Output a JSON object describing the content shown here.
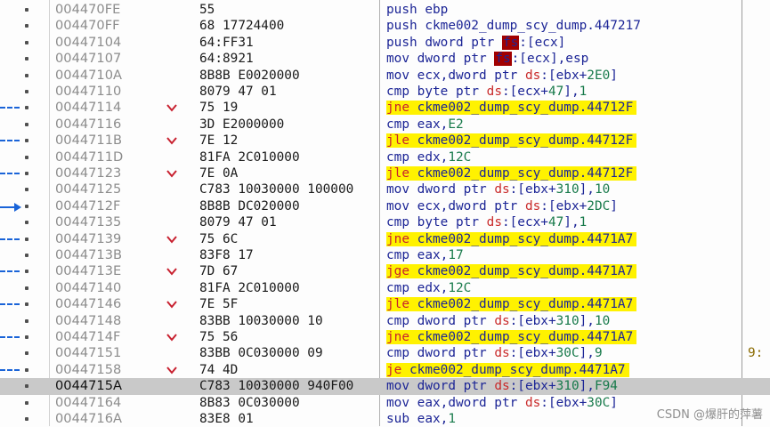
{
  "rows": [
    {
      "marker": "",
      "jump": false,
      "address": "004470FE",
      "bytes": "55",
      "mnemonic": "push",
      "operand": "ebp",
      "branch": false,
      "selected": false,
      "note": ""
    },
    {
      "marker": "",
      "jump": false,
      "address": "004470FF",
      "bytes": "68 17724400",
      "mnemonic": "push",
      "operand": "ckme002_dump_scy_dump.447217",
      "branch": false,
      "selected": false,
      "note": ""
    },
    {
      "marker": "",
      "jump": false,
      "address": "00447104",
      "bytes": "64:FF31",
      "mnemonic": "push",
      "operand": "dword ptr [[fs]]:[ecx]",
      "branch": false,
      "selected": false,
      "note": ""
    },
    {
      "marker": "",
      "jump": false,
      "address": "00447107",
      "bytes": "64:8921",
      "mnemonic": "mov",
      "operand": "dword ptr [[fs]]:[ecx],esp",
      "branch": false,
      "selected": false,
      "note": ""
    },
    {
      "marker": "",
      "jump": false,
      "address": "0044710A",
      "bytes": "8B8B E0020000",
      "mnemonic": "mov",
      "operand": "ecx,dword ptr ds:[ebx+2E0]",
      "branch": false,
      "selected": false,
      "note": ""
    },
    {
      "marker": "",
      "jump": false,
      "address": "00447110",
      "bytes": "8079 47 01",
      "mnemonic": "cmp",
      "operand": "byte ptr ds:[ecx+47],1",
      "branch": false,
      "selected": false,
      "note": ""
    },
    {
      "marker": "dash",
      "jump": true,
      "address": "00447114",
      "bytes": "75 19",
      "mnemonic": "jne",
      "operand": "ckme002_dump_scy_dump.44712F",
      "branch": true,
      "selected": false,
      "note": ""
    },
    {
      "marker": "",
      "jump": false,
      "address": "00447116",
      "bytes": "3D E2000000",
      "mnemonic": "cmp",
      "operand": "eax,E2",
      "branch": false,
      "selected": false,
      "note": ""
    },
    {
      "marker": "dash",
      "jump": true,
      "address": "0044711B",
      "bytes": "7E 12",
      "mnemonic": "jle",
      "operand": "ckme002_dump_scy_dump.44712F",
      "branch": true,
      "selected": false,
      "note": ""
    },
    {
      "marker": "",
      "jump": false,
      "address": "0044711D",
      "bytes": "81FA 2C010000",
      "mnemonic": "cmp",
      "operand": "edx,12C",
      "branch": false,
      "selected": false,
      "note": ""
    },
    {
      "marker": "dash",
      "jump": true,
      "address": "00447123",
      "bytes": "7E 0A",
      "mnemonic": "jle",
      "operand": "ckme002_dump_scy_dump.44712F",
      "branch": true,
      "selected": false,
      "note": ""
    },
    {
      "marker": "",
      "jump": false,
      "address": "00447125",
      "bytes": "C783 10030000 100000",
      "mnemonic": "mov",
      "operand": "dword ptr ds:[ebx+310],10",
      "branch": false,
      "selected": false,
      "note": ""
    },
    {
      "marker": "arrow",
      "jump": false,
      "address": "0044712F",
      "bytes": "8B8B DC020000",
      "mnemonic": "mov",
      "operand": "ecx,dword ptr ds:[ebx+2DC]",
      "branch": false,
      "selected": false,
      "note": ""
    },
    {
      "marker": "",
      "jump": false,
      "address": "00447135",
      "bytes": "8079 47 01",
      "mnemonic": "cmp",
      "operand": "byte ptr ds:[ecx+47],1",
      "branch": false,
      "selected": false,
      "note": ""
    },
    {
      "marker": "dash",
      "jump": true,
      "address": "00447139",
      "bytes": "75 6C",
      "mnemonic": "jne",
      "operand": "ckme002_dump_scy_dump.4471A7",
      "branch": true,
      "selected": false,
      "note": ""
    },
    {
      "marker": "",
      "jump": false,
      "address": "0044713B",
      "bytes": "83F8 17",
      "mnemonic": "cmp",
      "operand": "eax,17",
      "branch": false,
      "selected": false,
      "note": ""
    },
    {
      "marker": "dash",
      "jump": true,
      "address": "0044713E",
      "bytes": "7D 67",
      "mnemonic": "jge",
      "operand": "ckme002_dump_scy_dump.4471A7",
      "branch": true,
      "selected": false,
      "note": ""
    },
    {
      "marker": "",
      "jump": false,
      "address": "00447140",
      "bytes": "81FA 2C010000",
      "mnemonic": "cmp",
      "operand": "edx,12C",
      "branch": false,
      "selected": false,
      "note": ""
    },
    {
      "marker": "dash",
      "jump": true,
      "address": "00447146",
      "bytes": "7E 5F",
      "mnemonic": "jle",
      "operand": "ckme002_dump_scy_dump.4471A7",
      "branch": true,
      "selected": false,
      "note": ""
    },
    {
      "marker": "",
      "jump": false,
      "address": "00447148",
      "bytes": "83BB 10030000 10",
      "mnemonic": "cmp",
      "operand": "dword ptr ds:[ebx+310],10",
      "branch": false,
      "selected": false,
      "note": ""
    },
    {
      "marker": "dash",
      "jump": true,
      "address": "0044714F",
      "bytes": "75 56",
      "mnemonic": "jne",
      "operand": "ckme002_dump_scy_dump.4471A7",
      "branch": true,
      "selected": false,
      "note": ""
    },
    {
      "marker": "",
      "jump": false,
      "address": "00447151",
      "bytes": "83BB 0C030000 09",
      "mnemonic": "cmp",
      "operand": "dword ptr ds:[ebx+30C],9",
      "branch": false,
      "selected": false,
      "note": "9:"
    },
    {
      "marker": "dash",
      "jump": true,
      "address": "00447158",
      "bytes": "74 4D",
      "mnemonic": "je",
      "operand": "ckme002_dump_scy_dump.4471A7",
      "branch": true,
      "selected": false,
      "note": ""
    },
    {
      "marker": "",
      "jump": false,
      "address": "0044715A",
      "bytes": "C783 10030000 940F00",
      "mnemonic": "mov",
      "operand": "dword ptr ds:[ebx+310],F94",
      "branch": false,
      "selected": true,
      "note": ""
    },
    {
      "marker": "",
      "jump": false,
      "address": "00447164",
      "bytes": "8B83 0C030000",
      "mnemonic": "mov",
      "operand": "eax,dword ptr ds:[ebx+30C]",
      "branch": false,
      "selected": false,
      "note": ""
    },
    {
      "marker": "",
      "jump": false,
      "address": "0044716A",
      "bytes": "83E8 01",
      "mnemonic": "sub",
      "operand": "eax,1",
      "branch": false,
      "selected": false,
      "note": ""
    }
  ],
  "watermark": "CSDN @爆肝的萍薯",
  "colors": {
    "mnemonic": "#1c2596",
    "branch_mnemonic": "#c8202f",
    "number": "#187a4b",
    "segment": "#c92a2a",
    "branch_highlight": "#fff200",
    "selected_row": "#c9c9c9",
    "marker": "#1a64d8"
  },
  "icons": {
    "jump_chevron": "chevron-down-icon",
    "gutter_bullet": "breakpoint-dot-icon",
    "jump_arrow": "arrow-right-icon"
  }
}
